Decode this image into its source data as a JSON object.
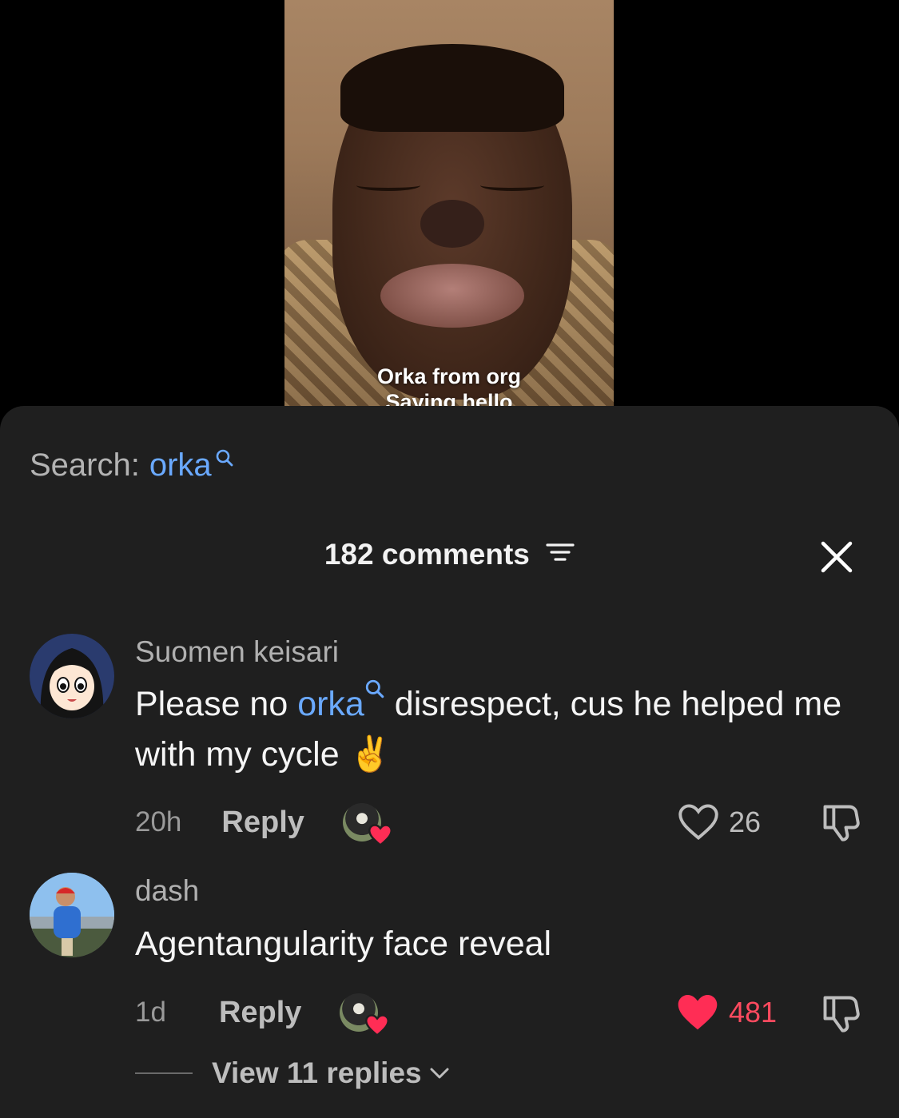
{
  "video": {
    "caption_line1": "Orka from org",
    "caption_line2": "Saying hello"
  },
  "search": {
    "label": "Search:",
    "keyword": "orka",
    "icon": "search-icon"
  },
  "header": {
    "title": "182 comments",
    "filter_icon": "filter-icon",
    "close_icon": "close-icon"
  },
  "comments": [
    {
      "username": "Suomen keisari",
      "text_before": "Please no ",
      "keyword": "orka",
      "text_after": " disrespect, cus he helped me with my cycle ✌️",
      "time": "20h",
      "reply_label": "Reply",
      "likes": "26",
      "liked": false
    },
    {
      "username": "dash",
      "text": "Agentangularity face reveal",
      "time": "1d",
      "reply_label": "Reply",
      "likes": "481",
      "liked": true,
      "view_replies": "View 11 replies"
    }
  ],
  "colors": {
    "accent": "#6aa9ff",
    "like_active": "#ff2d55",
    "sheet_bg": "#1f1f1f"
  }
}
